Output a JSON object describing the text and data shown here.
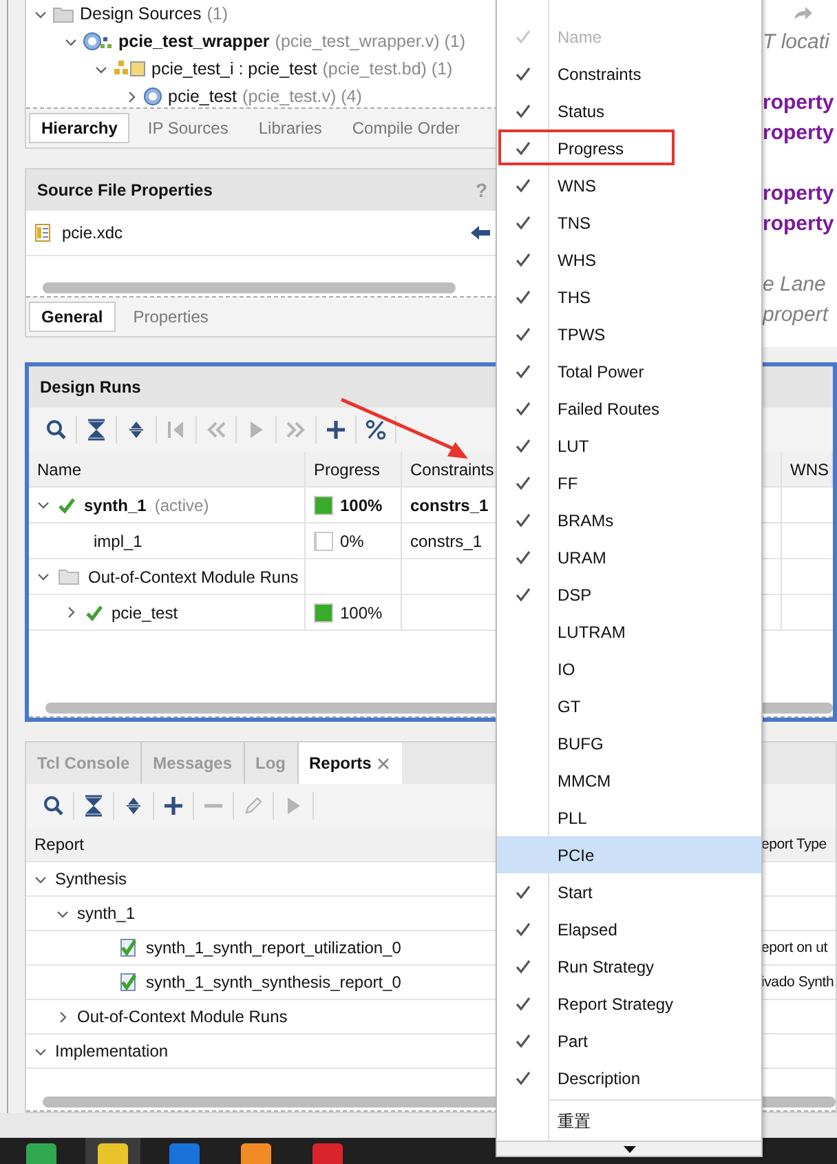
{
  "sources_tree": [
    {
      "label": "Design Sources",
      "note": "(1)",
      "kind": "folder",
      "expanded": true,
      "children": [
        {
          "label": "pcie_test_wrapper",
          "note": "(pcie_test_wrapper.v) (1)",
          "kind": "module-hier",
          "top_module": true,
          "expanded": true,
          "children": [
            {
              "label": "pcie_test_i : pcie_test",
              "note": "(pcie_test.bd) (1)",
              "kind": "block-design",
              "top_module": false,
              "expanded": true,
              "children": [
                {
                  "label": "pcie_test",
                  "note": "(pcie_test.v) (4)",
                  "kind": "module",
                  "top_module": false,
                  "expanded": false
                }
              ]
            }
          ]
        }
      ]
    }
  ],
  "source_tabs": [
    {
      "label": "Hierarchy",
      "selected": true
    },
    {
      "label": "IP Sources",
      "selected": false
    },
    {
      "label": "Libraries",
      "selected": false
    },
    {
      "label": "Compile Order",
      "selected": false
    }
  ],
  "properties_panel": {
    "title": "Source File Properties",
    "help": "?",
    "file": "pcie.xdc",
    "tabs": [
      {
        "label": "General",
        "selected": true
      },
      {
        "label": "Properties",
        "selected": false
      }
    ]
  },
  "editor_lines": [
    {
      "kind": "comment",
      "text": "T locati"
    },
    {
      "kind": "blank"
    },
    {
      "kind": "keyword",
      "text": "roperty"
    },
    {
      "kind": "keyword",
      "text": "roperty"
    },
    {
      "kind": "blank"
    },
    {
      "kind": "keyword",
      "text": "roperty"
    },
    {
      "kind": "keyword",
      "text": "roperty"
    },
    {
      "kind": "blank"
    },
    {
      "kind": "comment",
      "text": "e Lane"
    },
    {
      "kind": "comment",
      "text": "propert"
    }
  ],
  "design_runs": {
    "title": "Design Runs",
    "toolbar": [
      {
        "kind": "search",
        "disabled": false
      },
      {
        "kind": "collapse",
        "disabled": false
      },
      {
        "kind": "expand",
        "disabled": false
      },
      {
        "kind": "first",
        "disabled": true
      },
      {
        "kind": "prev",
        "disabled": true
      },
      {
        "kind": "play",
        "disabled": true
      },
      {
        "kind": "next",
        "disabled": true
      },
      {
        "kind": "plus",
        "disabled": false
      },
      {
        "kind": "percent",
        "disabled": false
      }
    ],
    "columns": [
      "Name",
      "Progress",
      "Constraints",
      "WNS"
    ],
    "rows": [
      {
        "kind": "run",
        "name": "synth_1",
        "note": "(active)",
        "active": true,
        "done": true,
        "expanded": true,
        "level": 1,
        "progress": "100%",
        "constraints": "constrs_1",
        "children": [
          {
            "kind": "run",
            "name": "impl_1",
            "active": false,
            "done": false,
            "level": 0,
            "progress": "0%",
            "constraints": "constrs_1"
          }
        ]
      },
      {
        "kind": "group",
        "name": "Out-of-Context Module Runs",
        "expanded": true,
        "children": [
          {
            "kind": "run",
            "name": "pcie_test",
            "active": false,
            "done": true,
            "expanded": false,
            "level": 1,
            "progress": "100%"
          }
        ]
      }
    ]
  },
  "reports_panel": {
    "tabs": [
      {
        "label": "Tcl Console",
        "selected": false,
        "closable": false
      },
      {
        "label": "Messages",
        "selected": false,
        "closable": false
      },
      {
        "label": "Log",
        "selected": false,
        "closable": false
      },
      {
        "label": "Reports",
        "selected": true,
        "closable": true
      }
    ],
    "toolbar": [
      {
        "kind": "search",
        "disabled": false
      },
      {
        "kind": "collapse",
        "disabled": false
      },
      {
        "kind": "expand",
        "disabled": false
      },
      {
        "kind": "plus",
        "disabled": false
      },
      {
        "kind": "minus",
        "disabled": true
      },
      {
        "kind": "pencil",
        "disabled": true
      },
      {
        "kind": "play",
        "disabled": true
      }
    ],
    "columns": [
      "Report",
      "eport Type"
    ],
    "rows": [
      {
        "kind": "group",
        "name": "Synthesis",
        "expanded": true,
        "children": [
          {
            "kind": "group",
            "name": "synth_1",
            "expanded": true,
            "children": [
              {
                "kind": "report",
                "name": "synth_1_synth_report_utilization_0",
                "type": "eport on ut"
              },
              {
                "kind": "report",
                "name": "synth_1_synth_synthesis_report_0",
                "type": "ivado Synth"
              }
            ]
          },
          {
            "kind": "group",
            "name": "Out-of-Context Module Runs",
            "expanded": false
          }
        ]
      },
      {
        "kind": "group",
        "name": "Implementation",
        "expanded": true
      }
    ]
  },
  "column_menu": {
    "items": [
      {
        "label": "Name",
        "checked": true,
        "disabled": true,
        "selected": false,
        "annotated": false
      },
      {
        "label": "Constraints",
        "checked": true,
        "disabled": false,
        "selected": false,
        "annotated": false
      },
      {
        "label": "Status",
        "checked": true,
        "disabled": false,
        "selected": false,
        "annotated": false
      },
      {
        "label": "Progress",
        "checked": true,
        "disabled": false,
        "selected": false,
        "annotated": true
      },
      {
        "label": "WNS",
        "checked": true,
        "disabled": false,
        "selected": false,
        "annotated": false
      },
      {
        "label": "TNS",
        "checked": true,
        "disabled": false,
        "selected": false,
        "annotated": false
      },
      {
        "label": "WHS",
        "checked": true,
        "disabled": false,
        "selected": false,
        "annotated": false
      },
      {
        "label": "THS",
        "checked": true,
        "disabled": false,
        "selected": false,
        "annotated": false
      },
      {
        "label": "TPWS",
        "checked": true,
        "disabled": false,
        "selected": false,
        "annotated": false
      },
      {
        "label": "Total Power",
        "checked": true,
        "disabled": false,
        "selected": false,
        "annotated": false
      },
      {
        "label": "Failed Routes",
        "checked": true,
        "disabled": false,
        "selected": false,
        "annotated": false
      },
      {
        "label": "LUT",
        "checked": true,
        "disabled": false,
        "selected": false,
        "annotated": false
      },
      {
        "label": "FF",
        "checked": true,
        "disabled": false,
        "selected": false,
        "annotated": false
      },
      {
        "label": "BRAMs",
        "checked": true,
        "disabled": false,
        "selected": false,
        "annotated": false
      },
      {
        "label": "URAM",
        "checked": true,
        "disabled": false,
        "selected": false,
        "annotated": false
      },
      {
        "label": "DSP",
        "checked": true,
        "disabled": false,
        "selected": false,
        "annotated": false
      },
      {
        "label": "LUTRAM",
        "checked": false,
        "disabled": false,
        "selected": false,
        "annotated": false
      },
      {
        "label": "IO",
        "checked": false,
        "disabled": false,
        "selected": false,
        "annotated": false
      },
      {
        "label": "GT",
        "checked": false,
        "disabled": false,
        "selected": false,
        "annotated": false
      },
      {
        "label": "BUFG",
        "checked": false,
        "disabled": false,
        "selected": false,
        "annotated": false
      },
      {
        "label": "MMCM",
        "checked": false,
        "disabled": false,
        "selected": false,
        "annotated": false
      },
      {
        "label": "PLL",
        "checked": false,
        "disabled": false,
        "selected": false,
        "annotated": false
      },
      {
        "label": "PCIe",
        "checked": false,
        "disabled": false,
        "selected": true,
        "annotated": false
      },
      {
        "label": "Start",
        "checked": true,
        "disabled": false,
        "selected": false,
        "annotated": false
      },
      {
        "label": "Elapsed",
        "checked": true,
        "disabled": false,
        "selected": false,
        "annotated": false
      },
      {
        "label": "Run Strategy",
        "checked": true,
        "disabled": false,
        "selected": false,
        "annotated": false
      },
      {
        "label": "Report Strategy",
        "checked": true,
        "disabled": false,
        "selected": false,
        "annotated": false
      },
      {
        "label": "Part",
        "checked": true,
        "disabled": false,
        "selected": false,
        "annotated": false
      },
      {
        "label": "Description",
        "checked": true,
        "disabled": false,
        "selected": false,
        "annotated": false
      }
    ],
    "reset": "重置"
  }
}
